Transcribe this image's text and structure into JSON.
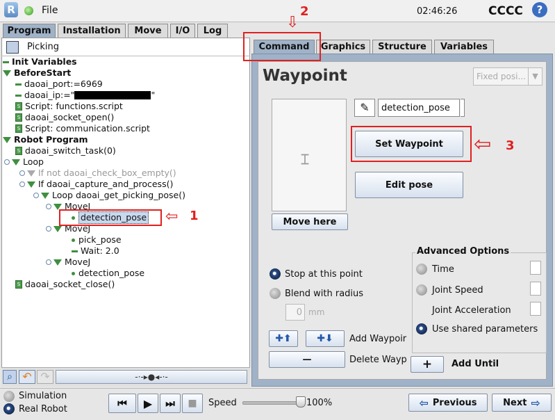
{
  "header": {
    "file": "File",
    "time": "02:46:26",
    "robot": "CCCC",
    "help": "?"
  },
  "tabs": {
    "program": "Program",
    "installation": "Installation",
    "move": "Move",
    "io": "I/O",
    "log": "Log"
  },
  "program_name": "Picking",
  "tree": {
    "init": "Init Variables",
    "before": "BeforeStart",
    "port": "daoai_port:=6969",
    "ip": "daoai_ip:=\"",
    "ip_end": "\"",
    "s1": "Script: functions.script",
    "sock": "daoai_socket_open()",
    "s2": "Script: communication.script",
    "robot": "Robot Program",
    "switch": "daoai_switch_task(0)",
    "loop": "Loop",
    "if1": "If  not daoai_check_box_empty()",
    "if2": "If daoai_capture_and_process()",
    "loop2": "Loop daoai_get_picking_pose()",
    "movej": "MoveJ",
    "det": "detection_pose",
    "pick": "pick_pose",
    "wait": "Wait: 2.0",
    "close": "daoai_socket_close()"
  },
  "cmdtabs": {
    "command": "Command",
    "graphics": "Graphics",
    "structure": "Structure",
    "variables": "Variables"
  },
  "waypoint": {
    "title": "Waypoint",
    "fixed": "Fixed posi...",
    "name": "detection_pose",
    "set": "Set Waypoint",
    "edit": "Edit pose",
    "move_here": "Move here"
  },
  "options": {
    "stop": "Stop at this point",
    "blend": "Blend with radius",
    "radius": "0",
    "mm": "mm",
    "adv": "Advanced Options",
    "time": "Time",
    "joint_speed": "Joint Speed",
    "joint_acc": "Joint Acceleration",
    "shared": "Use shared parameters"
  },
  "actions": {
    "add_wp": "Add Waypoir",
    "del_wp": "Delete Wayp",
    "add_until": "Add Until",
    "plus": "+",
    "minus": "—"
  },
  "annot": {
    "n1": "1",
    "n2": "2",
    "n3": "3"
  },
  "bottom": {
    "simulation": "Simulation",
    "real": "Real Robot",
    "speed": "Speed",
    "speed_val": "100%",
    "previous": "Previous",
    "next": "Next"
  },
  "speed_level": 1.0
}
